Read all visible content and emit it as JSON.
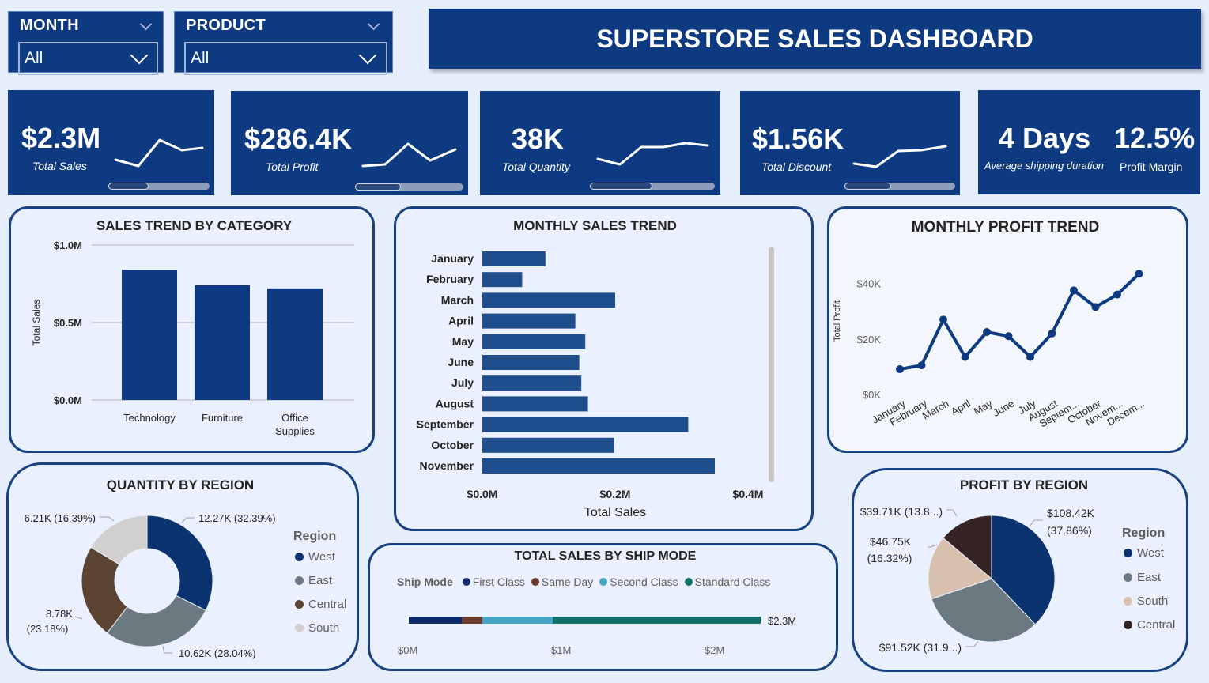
{
  "filters": {
    "month": {
      "title": "MONTH",
      "value": "All"
    },
    "product": {
      "title": "PRODUCT",
      "value": "All"
    }
  },
  "dashboard_title": "SUPERSTORE SALES DASHBOARD",
  "kpis": [
    {
      "value": "$2.3M",
      "label": "Total Sales",
      "scroll_position": 0.4
    },
    {
      "value": "$286.4K",
      "label": "Total Profit",
      "scroll_position": 0.42
    },
    {
      "value": "38K",
      "label": "Total Quantity",
      "scroll_position": 0.5
    },
    {
      "value": "$1.56K",
      "label": "Total Discount",
      "scroll_position": 0.42
    }
  ],
  "shipping": {
    "value": "4 Days",
    "label": "Average shipping duration"
  },
  "margin": {
    "value": "12.5%",
    "label": "Profit Margin"
  },
  "colors": {
    "navy": "#0d3a80",
    "bar": "#1f4e8c",
    "west": "#0b3370",
    "east": "#6b7a80",
    "central": "#5c4433",
    "south": "#d2cfcf",
    "south_profit": "#d8c0ae",
    "central_profit": "#362424",
    "first_class": "#0f2a6b",
    "same_day": "#6b3b2c",
    "second_class": "#46a5c6",
    "standard_class": "#136f6a"
  },
  "chart_data": [
    {
      "id": "sales_by_category",
      "type": "bar",
      "title": "SALES TREND BY CATEGORY",
      "ylabel": "Total Sales",
      "categories": [
        "Technology",
        "Furniture",
        "Office Supplies"
      ],
      "values": [
        0.84,
        0.74,
        0.72
      ],
      "yticks": [
        "$0.0M",
        "$0.5M",
        "$1.0M"
      ],
      "ylim": [
        0,
        1.0
      ],
      "grid": true
    },
    {
      "id": "monthly_sales",
      "type": "bar",
      "orientation": "horizontal",
      "title": "MONTHLY SALES TREND",
      "xlabel": "Total Sales",
      "categories": [
        "January",
        "February",
        "March",
        "April",
        "May",
        "June",
        "July",
        "August",
        "September",
        "October",
        "November"
      ],
      "values": [
        0.095,
        0.06,
        0.2,
        0.14,
        0.155,
        0.146,
        0.149,
        0.159,
        0.31,
        0.198,
        0.35
      ],
      "xticks": [
        "$0.0M",
        "$0.2M",
        "$0.4M"
      ],
      "xlim": [
        0,
        0.4
      ]
    },
    {
      "id": "monthly_profit",
      "type": "line",
      "title": "MONTHLY PROFIT TREND",
      "ylabel": "Total Profit",
      "categories": [
        "January",
        "February",
        "March",
        "April",
        "May",
        "June",
        "July",
        "August",
        "Septem...",
        "October",
        "Novem...",
        "Decem..."
      ],
      "values": [
        9.1,
        10.5,
        27.0,
        13.5,
        22.5,
        21.0,
        13.5,
        22.0,
        37.5,
        31.5,
        36.0,
        43.5
      ],
      "yticks": [
        "$0K",
        "$20K",
        "$40K"
      ],
      "ylim": [
        0,
        45
      ]
    },
    {
      "id": "quantity_by_region",
      "type": "pie",
      "variant": "donut",
      "title": "QUANTITY BY REGION",
      "legend_title": "Region",
      "legend": [
        "West",
        "East",
        "Central",
        "South"
      ],
      "slices": [
        {
          "name": "West",
          "value": 12.27,
          "label": "12.27K (32.39%)"
        },
        {
          "name": "East",
          "value": 10.62,
          "label": "10.62K (28.04%)"
        },
        {
          "name": "Central",
          "value": 8.78,
          "label_line1": "8.78K",
          "label_line2": "(23.18%)"
        },
        {
          "name": "South",
          "value": 6.21,
          "label": "6.21K (16.39%)"
        }
      ]
    },
    {
      "id": "sales_by_ship_mode",
      "type": "bar",
      "orientation": "stacked-horizontal",
      "title": "TOTAL SALES BY SHIP MODE",
      "legend_title": "Ship Mode",
      "legend": [
        "First Class",
        "Same Day",
        "Second Class",
        "Standard Class"
      ],
      "values": [
        0.35,
        0.13,
        0.46,
        1.36
      ],
      "total_label": "$2.3M",
      "xticks": [
        "$0M",
        "$1M",
        "$2M"
      ],
      "xlim": [
        0,
        2.3
      ]
    },
    {
      "id": "profit_by_region",
      "type": "pie",
      "title": "PROFIT BY REGION",
      "legend_title": "Region",
      "legend": [
        "West",
        "East",
        "South",
        "Central"
      ],
      "slices": [
        {
          "name": "West",
          "value": 108.42,
          "label_line1": "$108.42K",
          "label_line2": "(37.86%)"
        },
        {
          "name": "East",
          "value": 91.52,
          "label": "$91.52K (31.9...)"
        },
        {
          "name": "South",
          "value": 46.75,
          "label_line1": "$46.75K",
          "label_line2": "(16.32%)"
        },
        {
          "name": "Central",
          "value": 39.71,
          "label": "$39.71K (13.8...)"
        }
      ]
    }
  ]
}
